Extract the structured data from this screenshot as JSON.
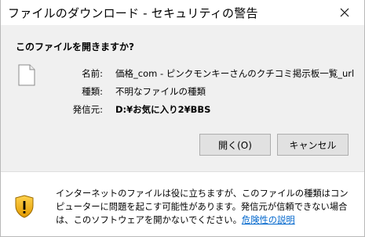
{
  "window": {
    "title": "ファイルのダウンロード - セキュリティの警告"
  },
  "dialog": {
    "question": "このファイルを開きますか?",
    "file_info": [
      {
        "label": "名前:",
        "value": "価格_com - ピンクモンキーさんのクチコミ掲示板一覧_url"
      },
      {
        "label": "種類:",
        "value": "不明なファイルの種類"
      },
      {
        "label": "発信元:",
        "value": "D:¥お気に入り2¥BBS"
      }
    ],
    "open_label": "開く(O)",
    "cancel_label": "キャンセル"
  },
  "warning": {
    "text": "インターネットのファイルは役に立ちますが、このファイルの種類はコンピューターに問題を起こす可能性があります。発信元が信頼できない場合は、このソフトウェアを開かないでください。",
    "link": "危険性の説明"
  },
  "icons": {
    "close": "close-icon",
    "file": "file-icon",
    "shield": "warning-shield-icon"
  }
}
